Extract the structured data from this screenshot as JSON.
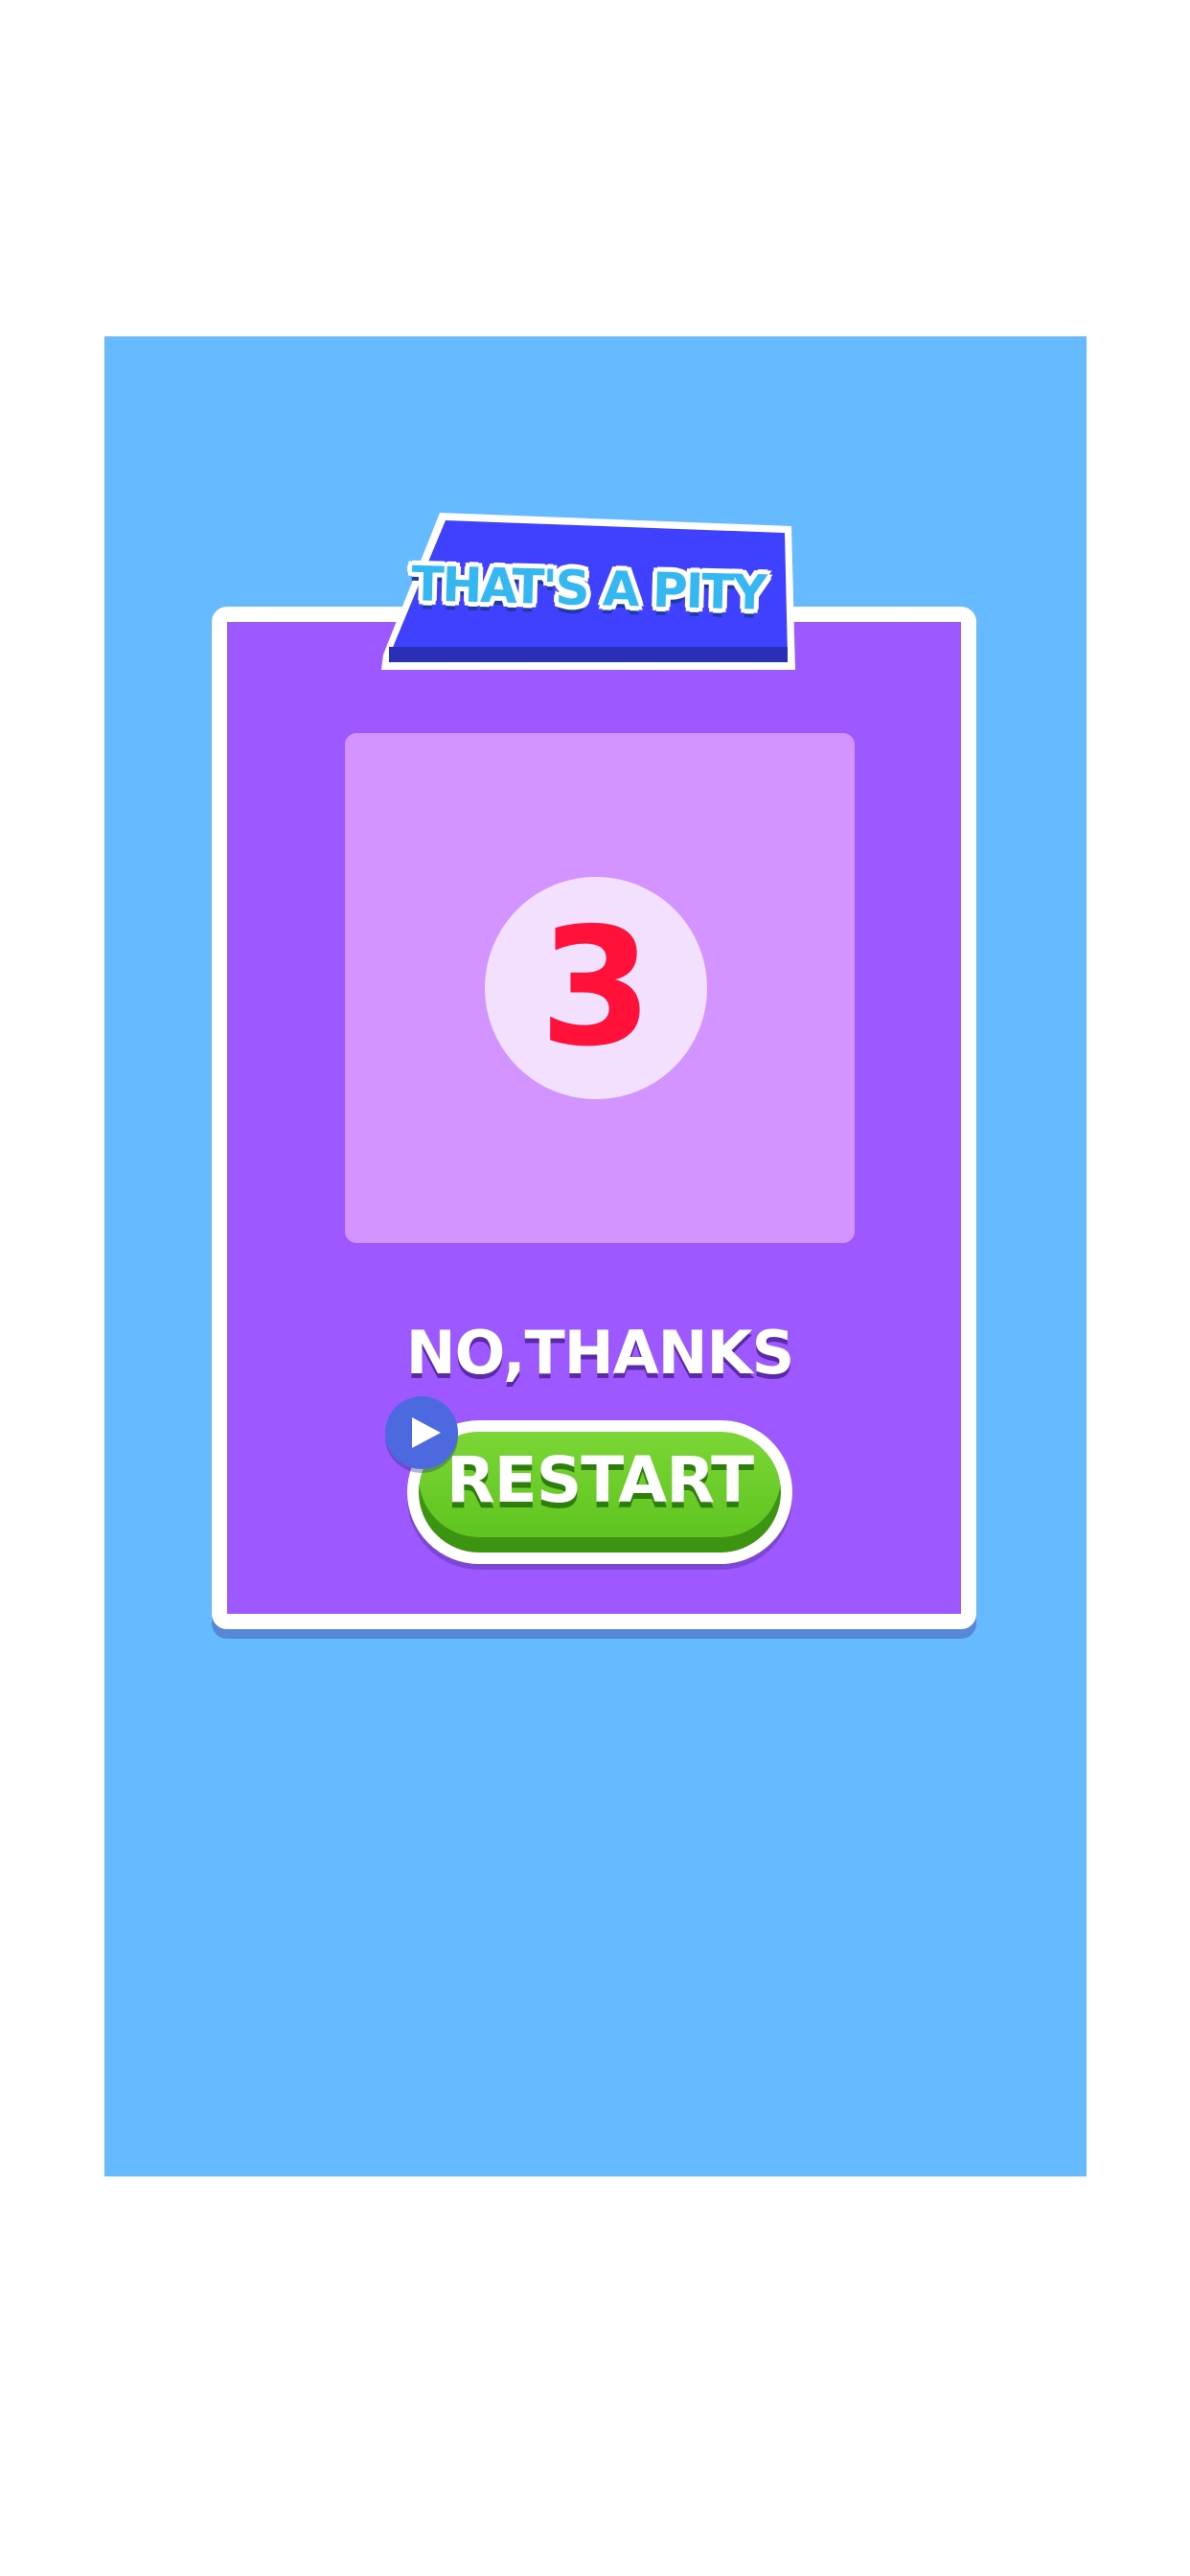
{
  "dialog": {
    "title": "THAT'S A PITY",
    "countdown": "3",
    "no_thanks_label": "NO,THANKS",
    "restart_label": "RESTART",
    "restart_icon": "play-icon"
  },
  "colors": {
    "page_background": "#ffffff",
    "game_background": "#66baff",
    "dialog_background": "#9e58ff",
    "dialog_border": "#ffffff",
    "title_banner": "#4040ff",
    "title_text": "#35b8f2",
    "countdown_panel": "#d494ff",
    "countdown_circle": "#f3dfff",
    "countdown_number": "#ff1139",
    "restart_button": "#5bc21c",
    "play_badge": "#4d69e0"
  }
}
